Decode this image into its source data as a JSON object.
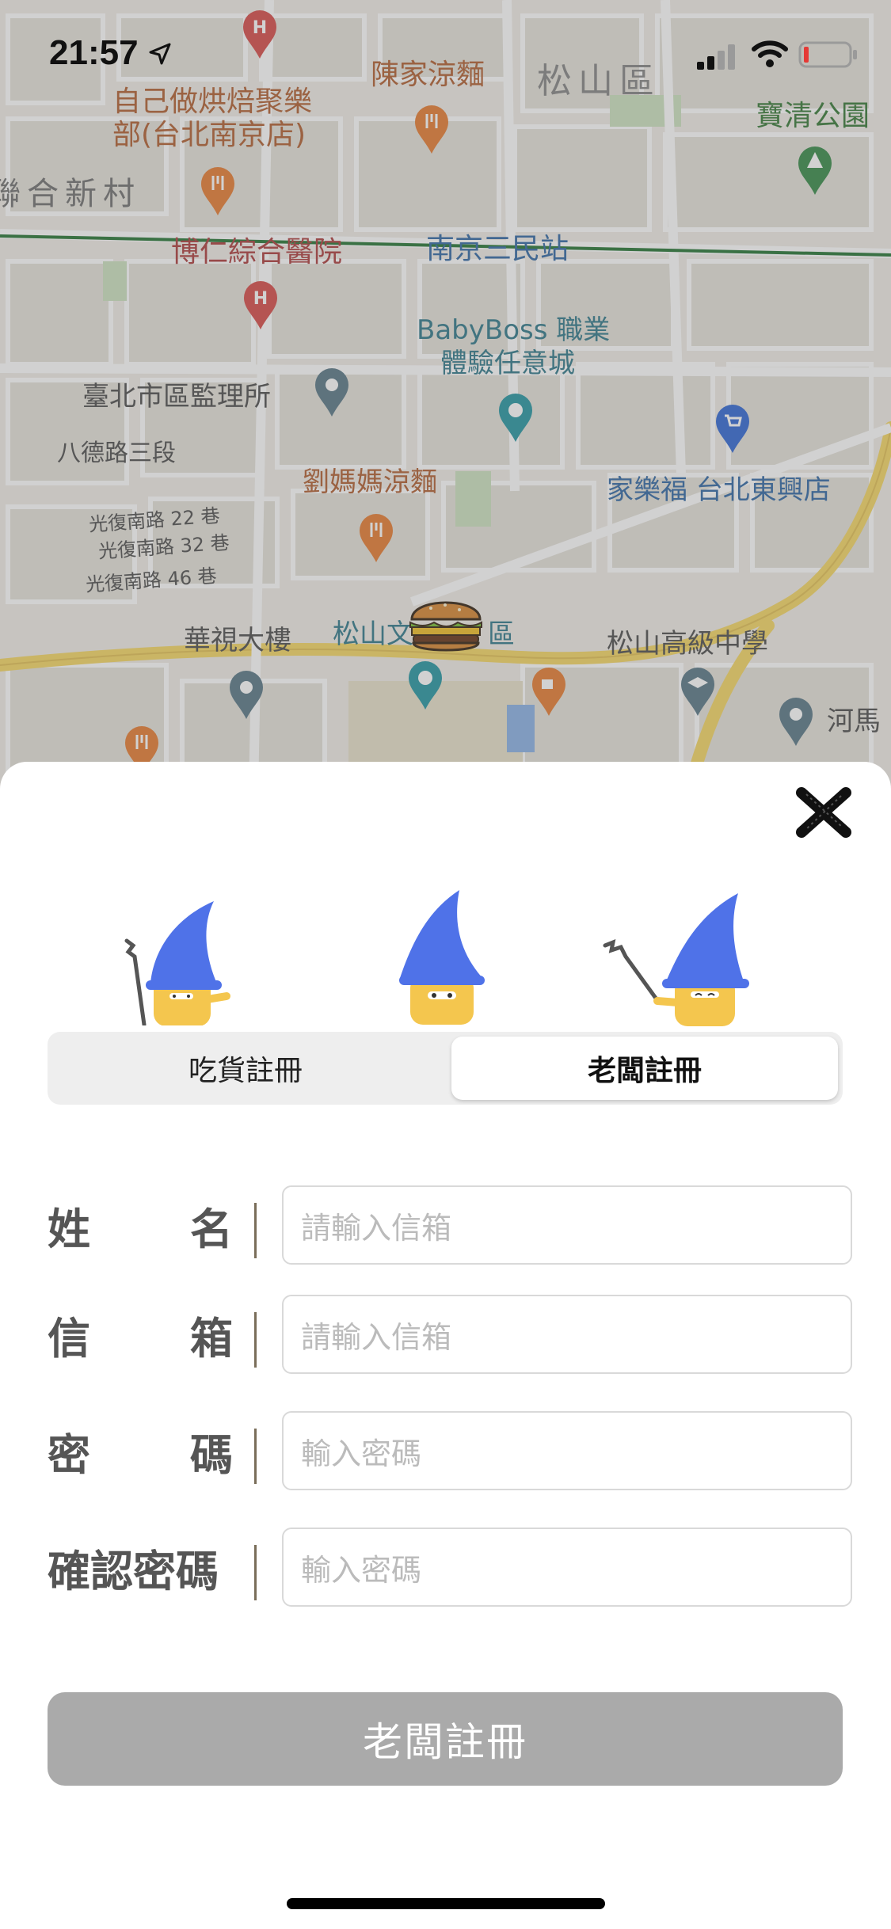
{
  "status_bar": {
    "time": "21:57"
  },
  "map": {
    "labels": [
      {
        "text": "陳家涼麵",
        "color": "#b4663a"
      },
      {
        "text": "松山區",
        "color": "#777"
      },
      {
        "text": "自己做烘焙聚樂",
        "color": "#b4663a"
      },
      {
        "text": "部(台北南京店)",
        "color": "#b4663a"
      },
      {
        "text": "寶清公園",
        "color": "#3f7f3f"
      },
      {
        "text": "聯合新村",
        "color": "#666"
      },
      {
        "text": "博仁綜合醫院",
        "color": "#b04545"
      },
      {
        "text": "南京三民站",
        "color": "#3a6ea8"
      },
      {
        "text": "BabyBoss 職業",
        "color": "#3a7f8f"
      },
      {
        "text": "體驗任意城",
        "color": "#3a7f8f"
      },
      {
        "text": "臺北市區監理所",
        "color": "#555"
      },
      {
        "text": "八德路三段",
        "color": "#555"
      },
      {
        "text": "劉媽媽涼麵",
        "color": "#b4663a"
      },
      {
        "text": "家樂福 台北東興店",
        "color": "#3a6ea8"
      },
      {
        "text": "光復南路 22 巷",
        "color": "#555"
      },
      {
        "text": "光復南路 32 巷",
        "color": "#555"
      },
      {
        "text": "光復南路 46 巷",
        "color": "#555"
      },
      {
        "text": "華視大樓",
        "color": "#555"
      },
      {
        "text": "松山文",
        "color": "#3a7f8f"
      },
      {
        "text": "區",
        "color": "#3a7f8f"
      },
      {
        "text": "松山高級中學",
        "color": "#555"
      },
      {
        "text": "河馬",
        "color": "#555"
      }
    ],
    "pins": {
      "hospital_icon": "H",
      "restaurant_icon": "fork-knife",
      "park_icon": "tree",
      "shop_icon": "cart",
      "school_icon": "cap",
      "cafe_icon": "cup",
      "museum_icon": "palette",
      "location_icon": "marker"
    }
  },
  "sheet": {
    "close_icon": "close-icon",
    "tabs": [
      {
        "label": "吃貨註冊",
        "selected": false
      },
      {
        "label": "老闆註冊",
        "selected": true
      }
    ],
    "form": {
      "name": {
        "label_a": "姓",
        "label_b": "名",
        "placeholder": "請輸入信箱"
      },
      "email": {
        "label_a": "信",
        "label_b": "箱",
        "placeholder": "請輸入信箱"
      },
      "password": {
        "label_a": "密",
        "label_b": "碼",
        "placeholder": "輸入密碼"
      },
      "confirm": {
        "label": "確認密碼",
        "placeholder": "輸入密碼"
      }
    },
    "submit_label": "老闆註冊"
  },
  "colors": {
    "wizard_hat": "#4f72e8",
    "wizard_body": "#f4c64e",
    "submit_disabled": "#aaaaaa"
  }
}
